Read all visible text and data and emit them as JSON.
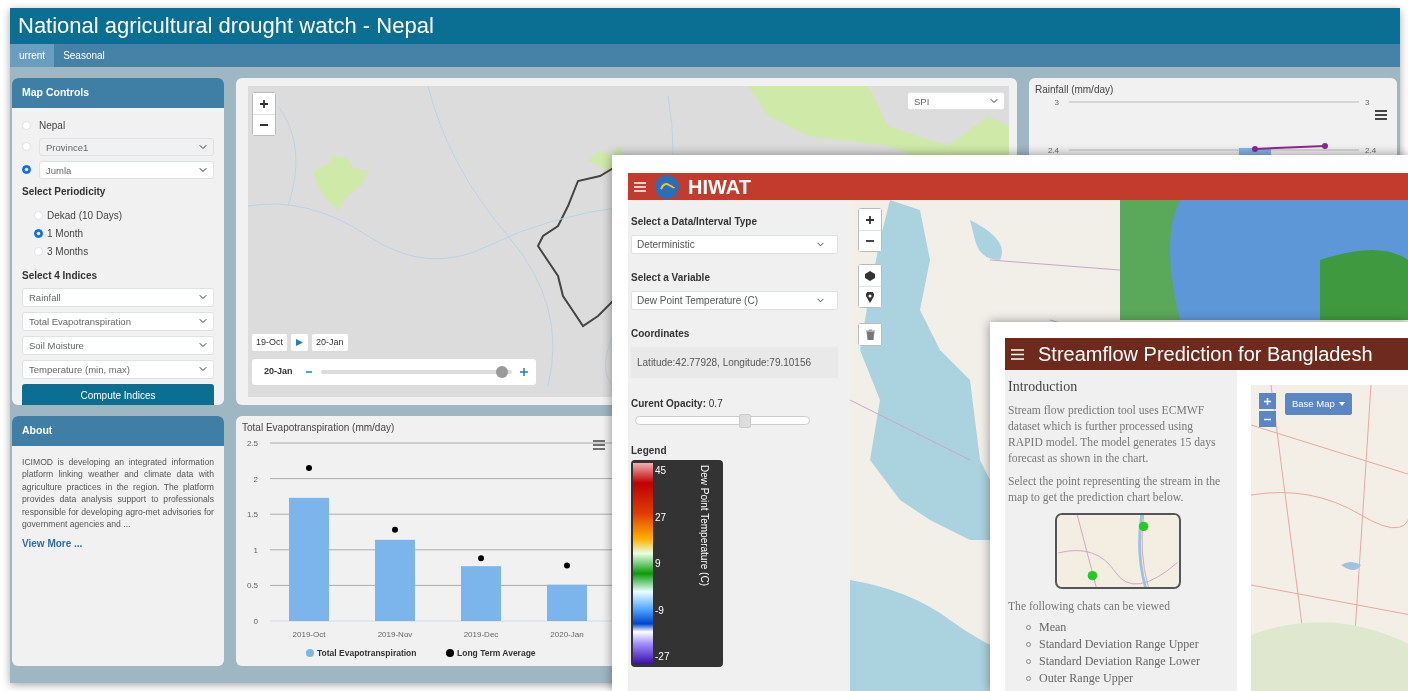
{
  "nepal_app": {
    "title": "National agricultural drought watch - Nepal",
    "tabs": [
      {
        "label": "urrent",
        "selected": true
      },
      {
        "label": "Seasonal",
        "selected": false
      }
    ],
    "map_controls": {
      "title": "Map Controls",
      "regions": [
        {
          "kind": "label",
          "text": "Nepal",
          "selected": false
        },
        {
          "kind": "select",
          "text": "Province1",
          "selected": false
        },
        {
          "kind": "select",
          "text": "Jumla",
          "selected": true
        }
      ],
      "periodicity_label": "Select Periodicity",
      "periodicity": [
        {
          "label": "Dekad (10 Days)",
          "selected": false
        },
        {
          "label": "1 Month",
          "selected": true
        },
        {
          "label": "3 Months",
          "selected": false
        }
      ],
      "indices_label": "Select 4 Indices",
      "indices": [
        "Rainfall",
        "Total Evapotranspiration",
        "Soil Moisture",
        "Temperature (min, max)"
      ],
      "compute_button": "Compute Indices"
    },
    "map": {
      "index_select": "SPI",
      "start_date": "19-Oct",
      "end_date": "20-Jan",
      "slider": {
        "label": "20-Jan",
        "level": 0.95
      }
    },
    "rainfall_chart": {
      "title": "Rainfall (mm/day)",
      "left_ticks": [
        "3",
        "2.4"
      ],
      "right_ticks": [
        "3",
        "2.4"
      ]
    },
    "about": {
      "title": "About",
      "text": "ICIMOD is developing an integrated information platform linking weather and climate data with agriculture practices in the region. The platform provides data analysis support to professionals responsible for developing agro-met advisories for government agencies and ...",
      "link": "View More ..."
    },
    "evapotranspiration_chart": {
      "title": "Total Evapotranspiration (mm/day)",
      "chart_data": {
        "type": "bar",
        "grid": true,
        "legend": "bottom",
        "categories": [
          "2019-Oct",
          "2019-Nov",
          "2019-Dec",
          "2020-Jan"
        ],
        "ylim": [
          0,
          2.5
        ],
        "yticks": [
          0,
          0.5,
          1,
          1.5,
          2,
          2.5
        ],
        "series": [
          {
            "name": "Total Evapotranspiration",
            "type": "bar",
            "color": "#7cb5ec",
            "values": [
              1.73,
              1.14,
              0.77,
              0.51
            ]
          },
          {
            "name": "Long Term Average",
            "type": "scatter",
            "color": "#000000",
            "values": [
              2.15,
              1.28,
              0.88,
              0.78
            ]
          }
        ]
      }
    }
  },
  "hiwat_app": {
    "title": "HIWAT",
    "data_type_label": "Select a Data/Interval Type",
    "data_type": "Deterministic",
    "variable_label": "Select a Variable",
    "variable": "Dew Point Temperature (C)",
    "coordinates_label": "Coordinates",
    "coordinates": "Latitude:42.77928, Longitude:79.10156",
    "opacity_label": "Curent Opacity:",
    "opacity_value": "0.7",
    "opacity_slider": {
      "level": 0.63
    },
    "legend_label": "Legend",
    "legend_title": "Dew Point Temperature (C)",
    "legend_ticks": [
      "45",
      "27",
      "9",
      "-9",
      "-27"
    ]
  },
  "streamflow_app": {
    "title": "Streamflow Prediction for Bangladesh",
    "heading": "Introduction",
    "paragraphs": [
      "Stream flow prediction tool uses ECMWF dataset which is further processed using RAPID model. The model generates 15 days forecast as shown in the chart.",
      "Select the point representing the stream in the map to get the prediction chart below."
    ],
    "charts_intro": "The following chats can be viewed",
    "charts": [
      "Mean",
      "Standard Deviation Range Upper",
      "Standard Deviation Range Lower",
      "Outer Range Upper"
    ],
    "base_map_button": "Base Map"
  }
}
